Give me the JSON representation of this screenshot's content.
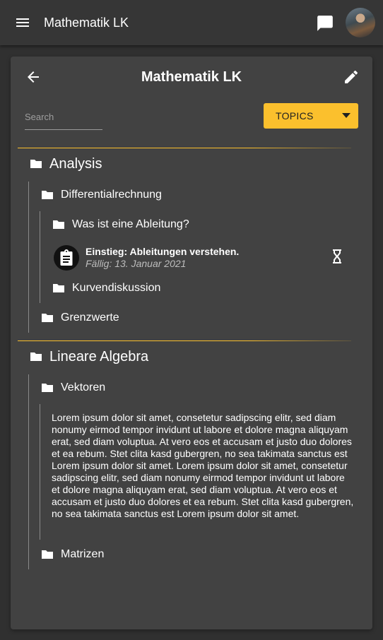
{
  "appbar": {
    "title": "Mathematik LK",
    "menu_icon": "menu-icon",
    "chat_icon": "chat-icon",
    "avatar": "user-avatar"
  },
  "card": {
    "title": "Mathematik LK",
    "back_icon": "arrow-left-icon",
    "edit_icon": "pencil-icon"
  },
  "search": {
    "placeholder": "Search",
    "value": ""
  },
  "topics_select": {
    "label": "TOPICS"
  },
  "colors": {
    "accent": "#fbc02d",
    "surface": "#424242",
    "background": "#303030",
    "appbar": "#363636"
  },
  "tree": [
    {
      "label": "Analysis",
      "children": [
        {
          "label": "Differentialrechnung",
          "children": [
            {
              "label": "Was ist eine Ableitung?"
            },
            {
              "task": {
                "title": "Einstieg: Ableitungen verstehen.",
                "due": "Fällig: 13. Januar 2021",
                "status_icon": "hourglass-icon"
              }
            },
            {
              "label": "Kurvendiskussion"
            }
          ]
        },
        {
          "label": "Grenzwerte"
        }
      ]
    },
    {
      "label": "Lineare Algebra",
      "children": [
        {
          "label": "Vektoren",
          "text": "Lorem ipsum dolor sit amet, consetetur sadipscing elitr, sed diam nonumy eirmod tempor invidunt ut labore et dolore magna aliquyam erat, sed diam voluptua. At vero eos et accusam et justo duo dolores et ea rebum. Stet clita kasd gubergren, no sea takimata sanctus est Lorem ipsum dolor sit amet. Lorem ipsum dolor sit amet, consetetur sadipscing elitr, sed diam nonumy eirmod tempor invidunt ut labore et dolore magna aliquyam erat, sed diam voluptua. At vero eos et accusam et justo duo dolores et ea rebum. Stet clita kasd gubergren, no sea takimata sanctus est Lorem ipsum dolor sit amet."
        },
        {
          "label": "Matrizen"
        }
      ]
    }
  ]
}
